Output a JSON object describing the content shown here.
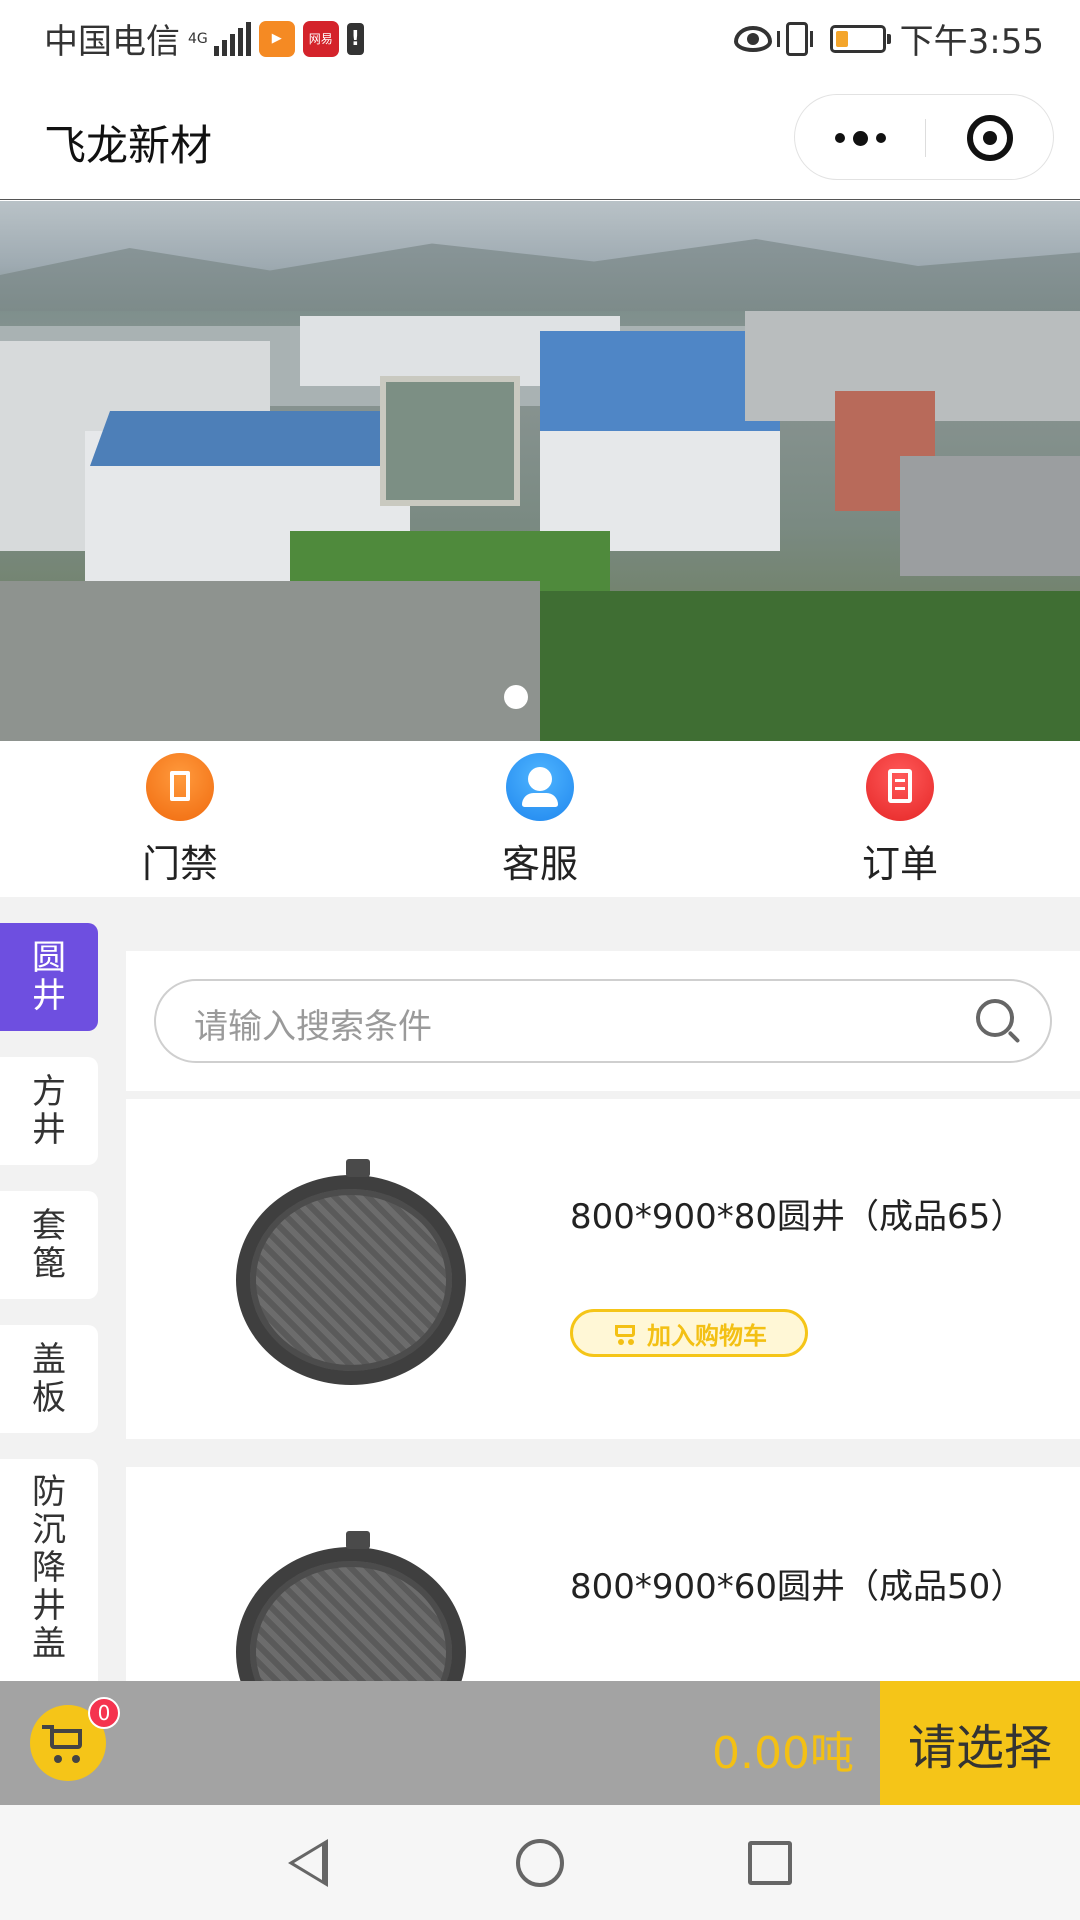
{
  "status_bar": {
    "carrier": "中国电信",
    "network": "4G",
    "notification_badge": "网易",
    "time": "下午3:55"
  },
  "header": {
    "title": "飞龙新材"
  },
  "quick_nav": [
    {
      "label": "门禁",
      "icon": "door-icon",
      "color": "#f57c1f"
    },
    {
      "label": "客服",
      "icon": "customer-service-icon",
      "color": "#2b95f2"
    },
    {
      "label": "订单",
      "icon": "order-clipboard-icon",
      "color": "#ea3333"
    }
  ],
  "categories": [
    {
      "label": "圆井",
      "active": true
    },
    {
      "label": "方井",
      "active": false
    },
    {
      "label": "套篦",
      "active": false
    },
    {
      "label": "盖板",
      "active": false
    },
    {
      "label": "防沉降井盖",
      "active": false
    }
  ],
  "search": {
    "placeholder": "请输入搜索条件"
  },
  "products": [
    {
      "name": "800*900*80圆井（成品65）",
      "cart_button": "加入购物车"
    },
    {
      "name": "800*900*60圆井（成品50）"
    }
  ],
  "cart_bar": {
    "badge_count": "0",
    "total": "0.00吨",
    "choose_button": "请选择"
  },
  "colors": {
    "accent_purple": "#6e4fe0",
    "accent_yellow": "#f5c518",
    "badge_red": "#f5334f"
  }
}
